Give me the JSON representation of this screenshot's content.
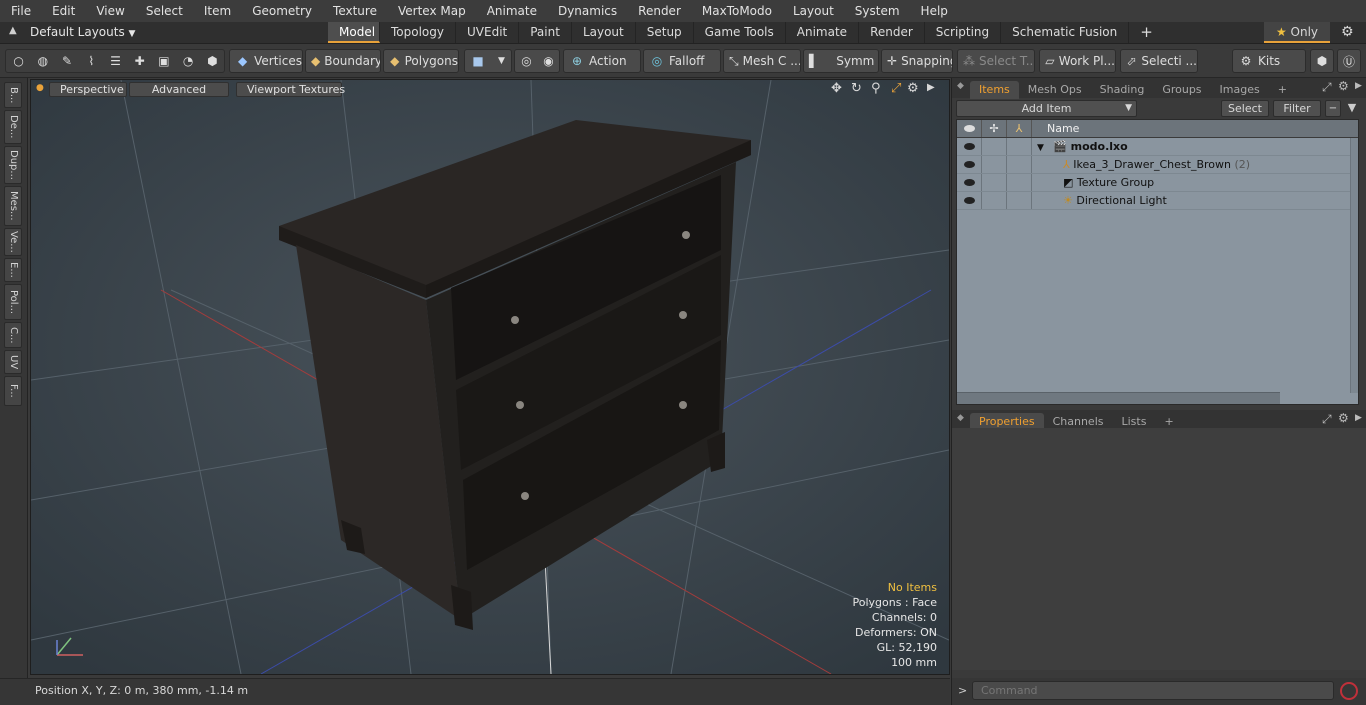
{
  "menubar": {
    "items": [
      "File",
      "Edit",
      "View",
      "Select",
      "Item",
      "Geometry",
      "Texture",
      "Vertex Map",
      "Animate",
      "Dynamics",
      "Render",
      "MaxToModo",
      "Layout",
      "System",
      "Help"
    ]
  },
  "layout": {
    "selector_label": "Default Layouts",
    "tabs": [
      "Model",
      "Topology",
      "UVEdit",
      "Paint",
      "Layout",
      "Setup",
      "Game Tools",
      "Animate",
      "Render",
      "Scripting",
      "Schematic Fusion"
    ],
    "active_tab": "Model",
    "only_label": "Only"
  },
  "toolbar": {
    "vertices": "Vertices",
    "boundary": "Boundary",
    "polygons": "Polygons",
    "action": "Action",
    "falloff": "Falloff",
    "mesh": "Mesh C ...",
    "symm": "Symm ...",
    "snapping": "Snapping",
    "select_t": "Select T...",
    "work_pl": "Work Pl...",
    "selecti": "Selecti ...",
    "kits": "Kits"
  },
  "lefttabs": [
    "B...",
    "De...",
    "Dup...",
    "Mes...",
    "Ve...",
    "E...",
    "Pol...",
    "C...",
    "UV",
    "F..."
  ],
  "viewport": {
    "perspective": "Perspective",
    "advanced": "Advanced",
    "viewport_textures": "Viewport Textures",
    "stats": {
      "no_items": "No Items",
      "polygons": "Polygons : Face",
      "channels": "Channels: 0",
      "deformers": "Deformers: ON",
      "gl": "GL: 52,190",
      "scale": "100 mm"
    }
  },
  "status": {
    "position": "Position X, Y, Z:   0 m, 380 mm, -1.14 m"
  },
  "items_panel": {
    "tabs": [
      "Items",
      "Mesh Ops",
      "Shading",
      "Groups",
      "Images"
    ],
    "active_tab": "Items",
    "add_item": "Add Item",
    "select": "Select",
    "filter": "Filter",
    "name_header": "Name",
    "rows": [
      {
        "name": "modo.lxo",
        "suffix": ""
      },
      {
        "name": "Ikea_3_Drawer_Chest_Brown",
        "suffix": "(2)"
      },
      {
        "name": "Texture Group",
        "suffix": ""
      },
      {
        "name": "Directional Light",
        "suffix": ""
      }
    ]
  },
  "props_panel": {
    "tabs": [
      "Properties",
      "Channels",
      "Lists"
    ],
    "active_tab": "Properties"
  },
  "command": {
    "placeholder": "Command"
  },
  "colors": {
    "accent": "#e8a23a",
    "viewport_bg": "#3e4850",
    "tree_bg": "#8a959f"
  }
}
